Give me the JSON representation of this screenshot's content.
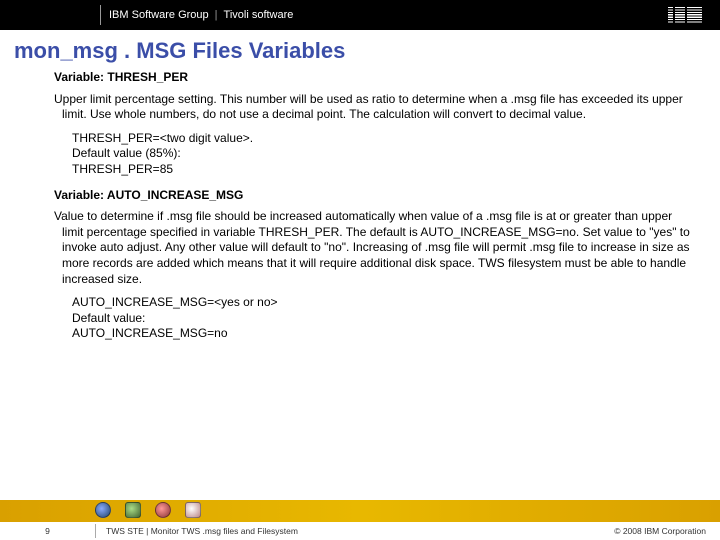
{
  "header": {
    "group": "IBM Software Group",
    "divider": "|",
    "product": "Tivoli software"
  },
  "title": "mon_msg . MSG Files Variables",
  "sections": [
    {
      "heading": "Variable: THRESH_PER",
      "paragraph": "Upper limit percentage setting. This number will be used as ratio to determine when a .msg file has exceeded its upper limit. Use whole numbers, do not use a decimal point. The calculation will convert to decimal value.",
      "syntax": [
        "THRESH_PER=<two digit value>.",
        "Default value (85%):",
        "THRESH_PER=85"
      ]
    },
    {
      "heading": "Variable: AUTO_INCREASE_MSG",
      "paragraph": "Value to determine if .msg file should be increased automatically when value of a .msg file is at or greater than upper limit percentage specified in variable THRESH_PER. The default is AUTO_INCREASE_MSG=no. Set value to \"yes\" to invoke auto adjust. Any other value will default to \"no\". Increasing of .msg file will permit .msg file to increase in size as more records are added which means that it will require additional disk space. TWS filesystem must be able to handle increased size.",
      "syntax": [
        "AUTO_INCREASE_MSG=<yes or no>",
        "Default value:",
        "AUTO_INCREASE_MSG=no"
      ]
    }
  ],
  "footer": {
    "page": "9",
    "text": "TWS STE | Monitor TWS .msg files and Filesystem",
    "copyright": "© 2008 IBM Corporation"
  }
}
